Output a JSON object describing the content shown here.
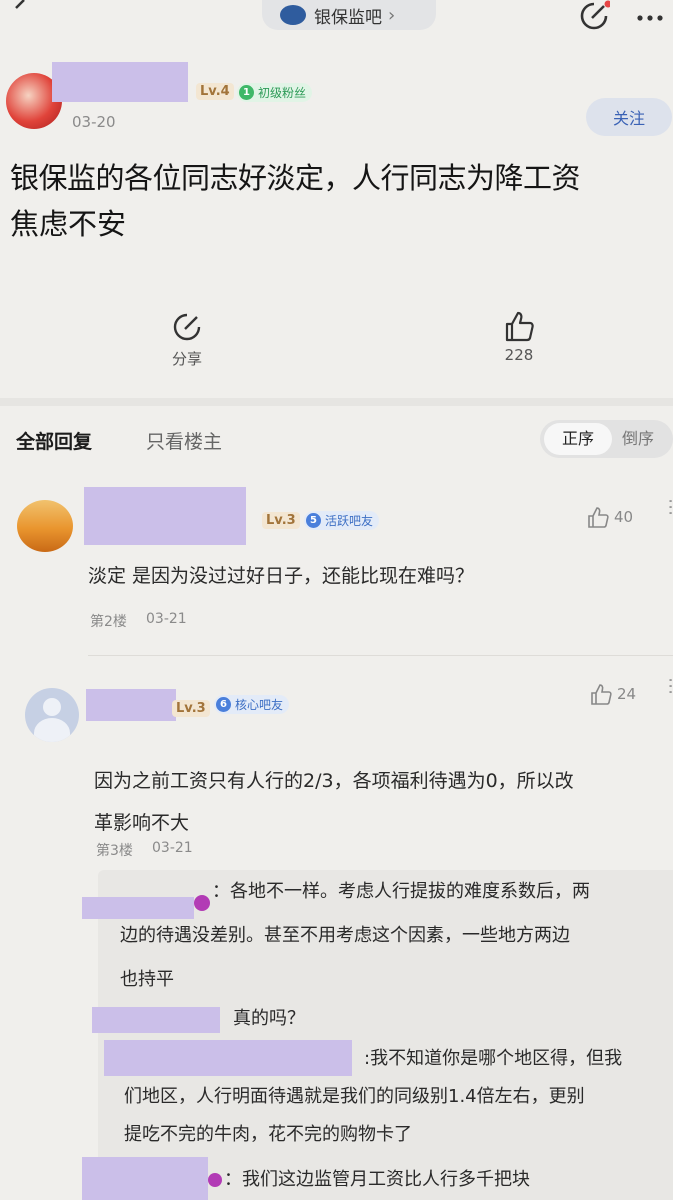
{
  "header": {
    "forum_name": "银保监吧",
    "chevron": "›"
  },
  "post": {
    "level": "Lv.4",
    "fan_badge_num": "1",
    "fan_badge": "初级粉丝",
    "date": "03-20",
    "follow_label": "关注",
    "title_line1": "银保监的各位同志好淡定，人行同志为降工资",
    "title_line2": "焦虑不安",
    "share_label": "分享",
    "like_count": "228"
  },
  "tabs": {
    "all_replies": "全部回复",
    "only_op": "只看楼主",
    "sort_asc": "正序",
    "sort_desc": "倒序"
  },
  "replies": [
    {
      "level": "Lv.3",
      "badge_num": "5",
      "badge": "活跃吧友",
      "likes": "40",
      "text": "淡定 是因为没过过好日子，还能比现在难吗？",
      "floor": "第2楼",
      "date": "03-21"
    },
    {
      "level": "Lv.3",
      "badge_num": "6",
      "badge": "核心吧友",
      "likes": "24",
      "text_line1": "因为之前工资只有人行的2/3，各项福利待遇为0，所以改",
      "text_line2": "革影响不大",
      "floor": "第3楼",
      "date": "03-21",
      "sub_replies": [
        {
          "lines": [
            "：各地不一样。考虑人行提拔的难度系数后，两",
            "边的待遇没差别。甚至不用考虑这个因素，一些地方两边",
            "也持平"
          ]
        },
        {
          "lines": [
            "真的吗？"
          ]
        },
        {
          "lines": [
            ":我不知道你是哪个地区得，但我",
            "们地区，人行明面待遇就是我们的同级别1.4倍左右，更别",
            "提吃不完的牛肉，花不完的购物卡了"
          ]
        },
        {
          "lines": [
            "：我们这边监管月工资比人行多千把块"
          ]
        }
      ]
    }
  ],
  "colors": {
    "accent_blue": "#3a7bd5",
    "fan_green": "#3fb868",
    "redaction": "#cbbfe9"
  }
}
